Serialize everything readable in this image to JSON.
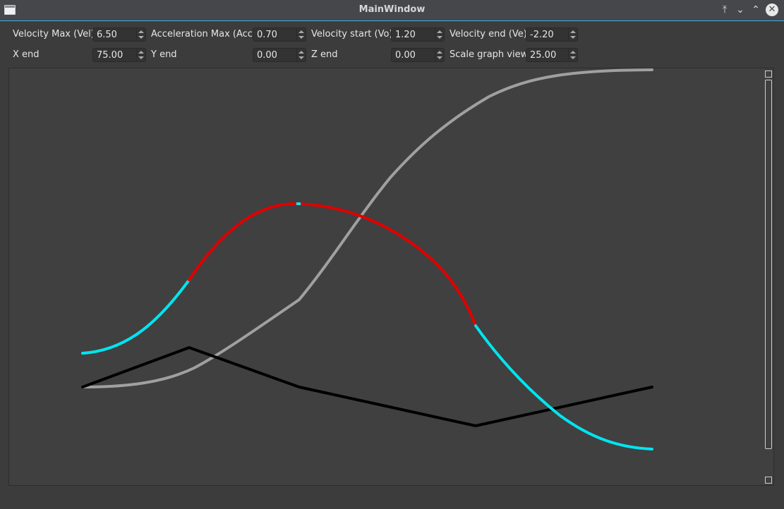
{
  "window": {
    "title": "MainWindow"
  },
  "params": [
    {
      "label": "Velocity Max (Vel)",
      "value": "6.50"
    },
    {
      "label": "Acceleration Max (Acc)",
      "value": "0.70"
    },
    {
      "label": "Velocity start (Vo)",
      "value": "1.20"
    },
    {
      "label": "Velocity end (Ve)",
      "value": "-2.20"
    },
    {
      "label": "X end",
      "value": "75.00"
    },
    {
      "label": "Y end",
      "value": "0.00"
    },
    {
      "label": "Z end",
      "value": "0.00"
    },
    {
      "label": "Scale graph view",
      "value": "25.00"
    }
  ],
  "colors": {
    "accent": "#3daee9",
    "velocity_ramp": "#00e5f0",
    "velocity_mid": "#e00000",
    "position": "#a0a0a0",
    "acceleration": "#000000"
  },
  "icons": {
    "app": "window-icon",
    "keep_above": "keep-above-icon",
    "minimize": "minimize-icon",
    "maximize": "maximize-icon",
    "close": "close-icon"
  }
}
